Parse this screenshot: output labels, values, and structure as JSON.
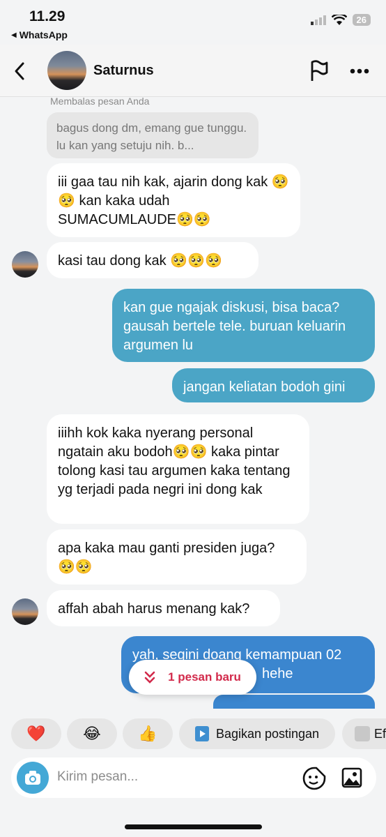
{
  "status": {
    "time": "11.29",
    "back_app": "WhatsApp",
    "battery": "26"
  },
  "header": {
    "contact_name": "Saturnus"
  },
  "reply": {
    "label": "Membalas pesan Anda",
    "quoted": "bagus dong dm, emang gue tunggu. lu kan yang setuju nih. b..."
  },
  "messages": [
    {
      "dir": "in",
      "text": "iii gaa tau nih kak, ajarin dong kak 🥺🥺 kan kaka udah SUMACUMLAUDE🥺🥺"
    },
    {
      "dir": "in",
      "text": "kasi tau dong kak 🥺🥺🥺"
    },
    {
      "dir": "out",
      "text": "kan gue ngajak diskusi, bisa baca? gausah bertele tele. buruan keluarin argumen lu"
    },
    {
      "dir": "out",
      "text": "jangan keliatan bodoh gini"
    },
    {
      "dir": "in",
      "text": "iiihh kok kaka nyerang personal ngatain aku bodoh🥺🥺 kaka pintar tolong kasi tau argumen kaka tentang yg terjadi pada negri ini dong kak"
    },
    {
      "dir": "in",
      "text": "apa kaka mau ganti presiden juga? 🥺🥺"
    },
    {
      "dir": "in",
      "text": "affah abah harus menang kak?"
    },
    {
      "dir": "out",
      "text": "yah, segini doang kemampuan 02",
      "text2": "hehe"
    }
  ],
  "new_messages": {
    "label": "1 pesan baru"
  },
  "quick_replies": [
    {
      "emoji": "❤️"
    },
    {
      "emoji": "😂"
    },
    {
      "emoji": "👍"
    },
    {
      "label": "Bagikan postingan"
    },
    {
      "label": "Ef"
    }
  ],
  "composer": {
    "placeholder": "Kirim pesan..."
  },
  "colors": {
    "incoming": "#ffffff",
    "outgoing": "#4ba5c6",
    "outgoing_dark": "#3b86cf",
    "accent": "#d22a4b"
  },
  "icons": [
    "back-chevron-icon",
    "flag-icon",
    "more-icon",
    "camera-icon",
    "sticker-icon",
    "gallery-icon",
    "double-chevron-down-icon",
    "play-icon"
  ]
}
